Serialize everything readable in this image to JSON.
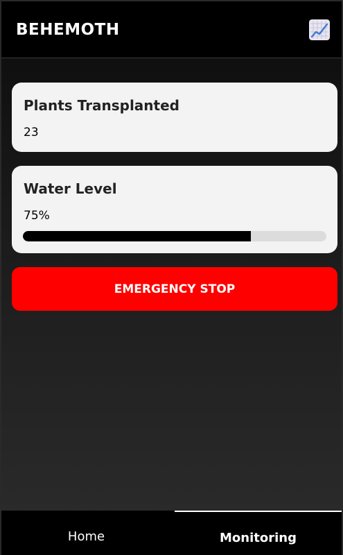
{
  "app": {
    "title": "BEHEMOTH",
    "header_icon": "chart-increasing-icon"
  },
  "plants": {
    "title": "Plants Transplanted",
    "value": "23"
  },
  "water": {
    "title": "Water Level",
    "value": "75%",
    "level": 0.75
  },
  "emergency": {
    "label": "EMERGENCY STOP",
    "color": "#ff0000"
  },
  "nav": {
    "tabs": [
      {
        "label": "Home",
        "active": false
      },
      {
        "label": "Monitoring",
        "active": true
      }
    ]
  }
}
